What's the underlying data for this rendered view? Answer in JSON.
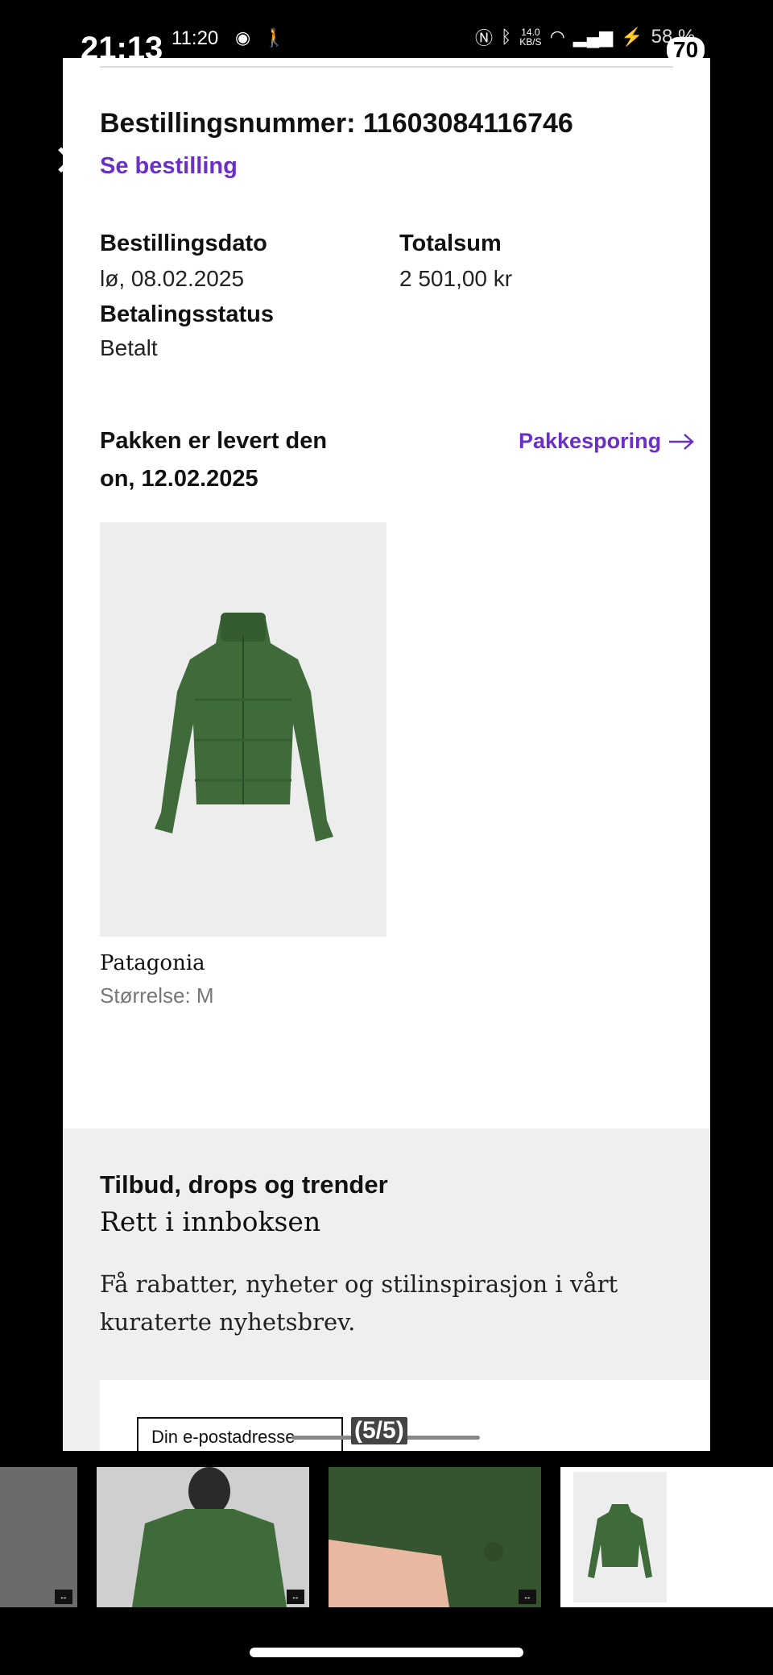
{
  "status_bar": {
    "outer_time": "21:13",
    "inner_time": "11:20",
    "net_speed_value": "14.0",
    "net_speed_unit": "KB/S",
    "battery": "58 %",
    "badge": "70"
  },
  "order": {
    "number_label": "Bestillingsnummer: 11603084116746",
    "see_order_link": "Se bestilling",
    "date_label": "Bestillingsdato",
    "date_value": "lø, 08.02.2025",
    "total_label": "Totalsum",
    "total_value": "2 501,00 kr",
    "payment_label": "Betalingsstatus",
    "payment_value": "Betalt"
  },
  "delivery": {
    "line1": "Pakken er levert den",
    "line2": "on, 12.02.2025",
    "tracking_link": "Pakkesporing"
  },
  "product": {
    "brand": "Patagonia",
    "size": "Størrelse: M"
  },
  "newsletter": {
    "title": "Tilbud, drops og trender",
    "subtitle": "Rett i innboksen",
    "text": "Få rabatter, nyheter og stilinspirasjon i vårt kuraterte nyhetsbrev.",
    "email_placeholder": "Din e-postadresse"
  },
  "gallery": {
    "pager": "(5/5)"
  },
  "colors": {
    "accent": "#6a2fc4",
    "jacket_green": "#3f6a3a"
  }
}
